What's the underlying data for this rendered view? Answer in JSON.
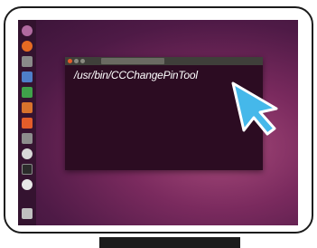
{
  "terminal": {
    "command": "/usr/bin/CCChangePinTool"
  },
  "launcher": {
    "icons": [
      {
        "name": "dash-icon",
        "color": "#b06aa0"
      },
      {
        "name": "firefox-icon",
        "color": "#e66a22"
      },
      {
        "name": "files-icon",
        "color": "#8a8a8a"
      },
      {
        "name": "writer-icon",
        "color": "#4e7fc9"
      },
      {
        "name": "calc-icon",
        "color": "#3fa14a"
      },
      {
        "name": "impress-icon",
        "color": "#d8722c"
      },
      {
        "name": "software-center-icon",
        "color": "#e35d2a"
      },
      {
        "name": "settings-icon",
        "color": "#8d8d8d"
      },
      {
        "name": "help-icon",
        "color": "#d8d8d8"
      },
      {
        "name": "terminal-icon",
        "color": "#2b2b2b"
      },
      {
        "name": "dvd-icon",
        "color": "#e8e8e8"
      },
      {
        "name": "trash-icon",
        "color": "#c0c0c0"
      }
    ]
  },
  "colors": {
    "desktop": "#7a2a5e",
    "terminal_bg": "#2c0c22",
    "cursor": "#45b8ea"
  }
}
